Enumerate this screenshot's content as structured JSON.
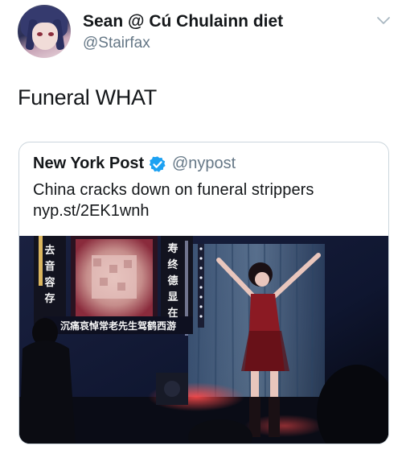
{
  "tweet": {
    "author": {
      "display_name": "Sean @ Cú Chulainn diet",
      "handle": "@Stairfax",
      "avatar_icon": "anime-avatar"
    },
    "text": "Funeral WHAT",
    "menu_icon": "chevron-down-icon"
  },
  "quoted_tweet": {
    "author": {
      "display_name": "New York Post",
      "verified": true,
      "handle": "@nypost"
    },
    "text": "China cracks down on funeral strippers",
    "link": "nyp.st/2EK1wnh",
    "media": {
      "description_icon": "photo",
      "banner_left": [
        "去",
        "音",
        "容",
        "存"
      ],
      "banner_right": [
        "寿",
        "终",
        "德",
        "显",
        "在"
      ],
      "banner_bottom": "沉痛哀悼常老先生驾鹤西游"
    }
  },
  "colors": {
    "text": "#14171a",
    "secondary": "#657786",
    "border": "#ccd6dd",
    "verified": "#1da1f2"
  }
}
